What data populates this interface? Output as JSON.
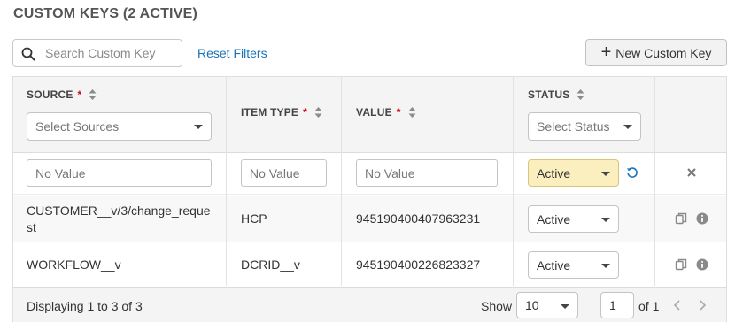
{
  "title": "CUSTOM KEYS (2 ACTIVE)",
  "search": {
    "placeholder": "Search Custom Key"
  },
  "reset_filters": "Reset Filters",
  "new_button": {
    "label": "New Custom Key",
    "icon": "plus-icon"
  },
  "columns": {
    "source": {
      "label": "SOURCE",
      "required": "*",
      "filter_placeholder": "Select Sources"
    },
    "item_type": {
      "label": "ITEM TYPE",
      "required": "*"
    },
    "value": {
      "label": "VALUE",
      "required": "*"
    },
    "status": {
      "label": "STATUS",
      "filter_placeholder": "Select Status"
    }
  },
  "filter_row": {
    "source_placeholder": "No Value",
    "item_type_placeholder": "No Value",
    "value_placeholder": "No Value",
    "status": "Active"
  },
  "rows": [
    {
      "source_line1": "CUSTOMER__v/3/change_reque",
      "source_line2": "st",
      "item_type": "HCP",
      "value": "945190400407963231",
      "status": "Active"
    },
    {
      "source_line1": "WORKFLOW__v",
      "source_line2": "",
      "item_type": "DCRID__v",
      "value": "945190400226823327",
      "status": "Active"
    }
  ],
  "footer": {
    "displaying": "Displaying 1 to 3 of 3",
    "show_label": "Show",
    "page_size": "10",
    "page": "1",
    "of_pages": "of 1"
  },
  "colors": {
    "link": "#1a73b8",
    "required": "#d0021b",
    "active_highlight": "#fbefc0",
    "header_bg": "#f4f4f4"
  }
}
